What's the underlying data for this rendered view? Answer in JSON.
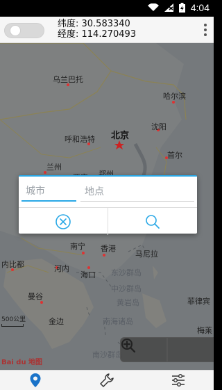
{
  "status_bar": {
    "time": "4:04"
  },
  "header": {
    "latitude": "纬度: 30.583340",
    "longitude": "经度: 114.270493"
  },
  "map": {
    "labels": [
      {
        "name": "乌兰巴托"
      },
      {
        "name": "哈尔滨"
      },
      {
        "name": "呼和浩特"
      },
      {
        "name": "北京"
      },
      {
        "name": "沈阳"
      },
      {
        "name": "首尔"
      },
      {
        "name": "兰州"
      },
      {
        "name": "西安"
      },
      {
        "name": "郑州"
      },
      {
        "name": "南宁"
      },
      {
        "name": "香港"
      },
      {
        "name": "内比都"
      },
      {
        "name": "河内"
      },
      {
        "name": "海口"
      },
      {
        "name": "东沙群岛"
      },
      {
        "name": "曼谷"
      },
      {
        "name": "金边"
      },
      {
        "name": "菲律宾"
      },
      {
        "name": "南沙群岛"
      },
      {
        "name": "中沙群岛"
      },
      {
        "name": "马尼拉"
      },
      {
        "name": "黄岩岛"
      },
      {
        "name": "南海诸岛"
      },
      {
        "name": "梅莱"
      }
    ],
    "scale": "500公里",
    "logo": "Bai du 地图"
  },
  "search_dialog": {
    "city_placeholder": "城市",
    "place_placeholder": "地点"
  },
  "colors": {
    "accent": "#2aa8e6",
    "map_bg": "#6f7377",
    "nav_active": "#1a73c9"
  }
}
